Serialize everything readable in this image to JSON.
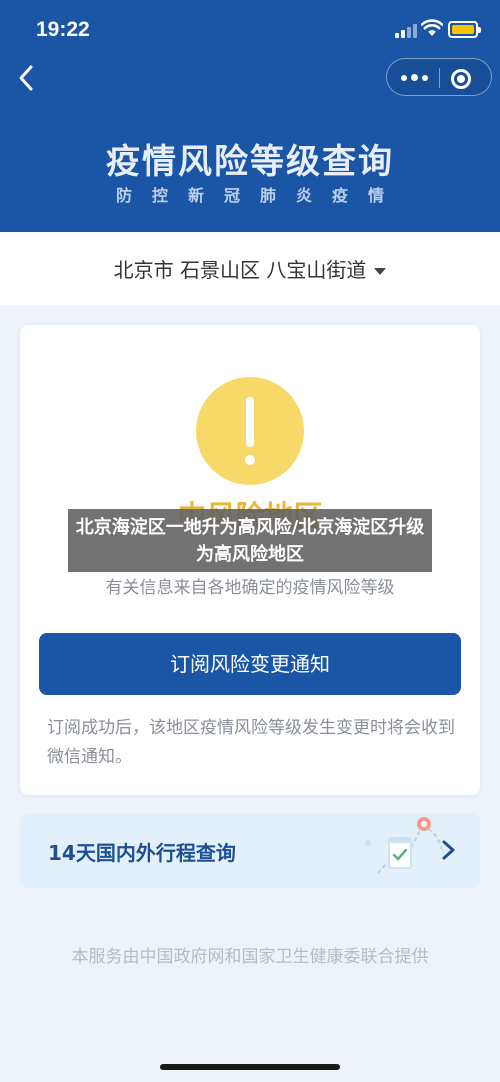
{
  "status_bar": {
    "time": "19:22"
  },
  "header": {
    "title": "疫情风险等级查询",
    "subtitle": "防控新冠肺炎疫情"
  },
  "location": {
    "text": "北京市 石景山区 八宝山街道"
  },
  "risk_card": {
    "level": "中风险地区",
    "description": "有关信息来自各地确定的疫情风险等级",
    "subscribe_label": "订阅风险变更通知",
    "subscribe_note": "订阅成功后，该地区疫情风险等级发生变更时将会收到微信通知。"
  },
  "trip_card": {
    "label": "14天国内外行程查询"
  },
  "footer": {
    "note": "本服务由中国政府网和国家卫生健康委联合提供"
  },
  "overlay": {
    "caption": "北京海淀区一地升为高风险/北京海淀区升级为高风险地区"
  },
  "colors": {
    "primary": "#1b55a5",
    "warning": "#f7d96a",
    "battery": "#f6c400"
  },
  "icons": [
    "back-icon",
    "more-icon",
    "close-mini-program-icon",
    "dropdown-caret-icon",
    "alert-icon",
    "chevron-right-icon"
  ]
}
